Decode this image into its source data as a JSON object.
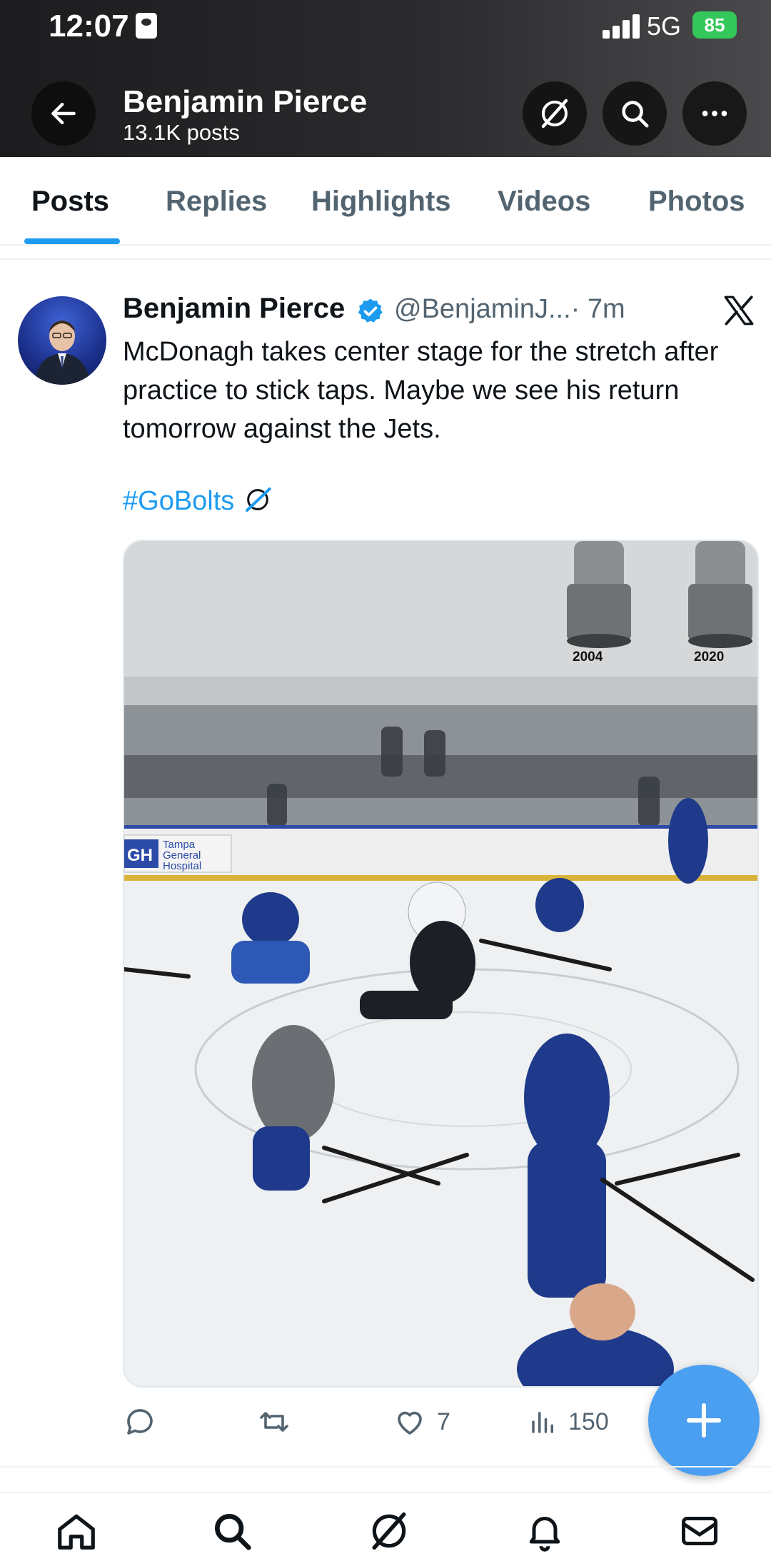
{
  "status_bar": {
    "time": "12:07",
    "network": "5G",
    "battery": "85"
  },
  "header": {
    "name": "Benjamin Pierce",
    "posts_count": "13.1K posts",
    "icons": [
      "back-arrow-icon",
      "lightning-bolt-logo-icon",
      "search-icon",
      "more-icon"
    ]
  },
  "tabs": [
    {
      "label": "Posts",
      "active": true
    },
    {
      "label": "Replies",
      "active": false
    },
    {
      "label": "Highlights",
      "active": false
    },
    {
      "label": "Videos",
      "active": false
    },
    {
      "label": "Photos",
      "active": false
    }
  ],
  "post": {
    "author": "Benjamin Pierce",
    "handle": "@BenjaminJ...",
    "time": "· 7m",
    "text": "McDonagh takes center stage for the stretch after practice to stick taps. Maybe we see his return tomorrow against the Jets.",
    "hashtag": "#GoBolts",
    "media": {
      "banner_years": [
        "2004",
        "2020"
      ],
      "sign_text": [
        "GH",
        "Tampa",
        "General",
        "Hospital"
      ]
    },
    "actions": {
      "reply_count": "",
      "repost_count": "",
      "like_count": "7",
      "views_count": "150"
    }
  },
  "accent_color": "#1d9bf0",
  "bottom_nav": [
    "home-icon",
    "search-icon",
    "lightning-bolt-logo-icon",
    "notifications-icon",
    "messages-icon"
  ]
}
